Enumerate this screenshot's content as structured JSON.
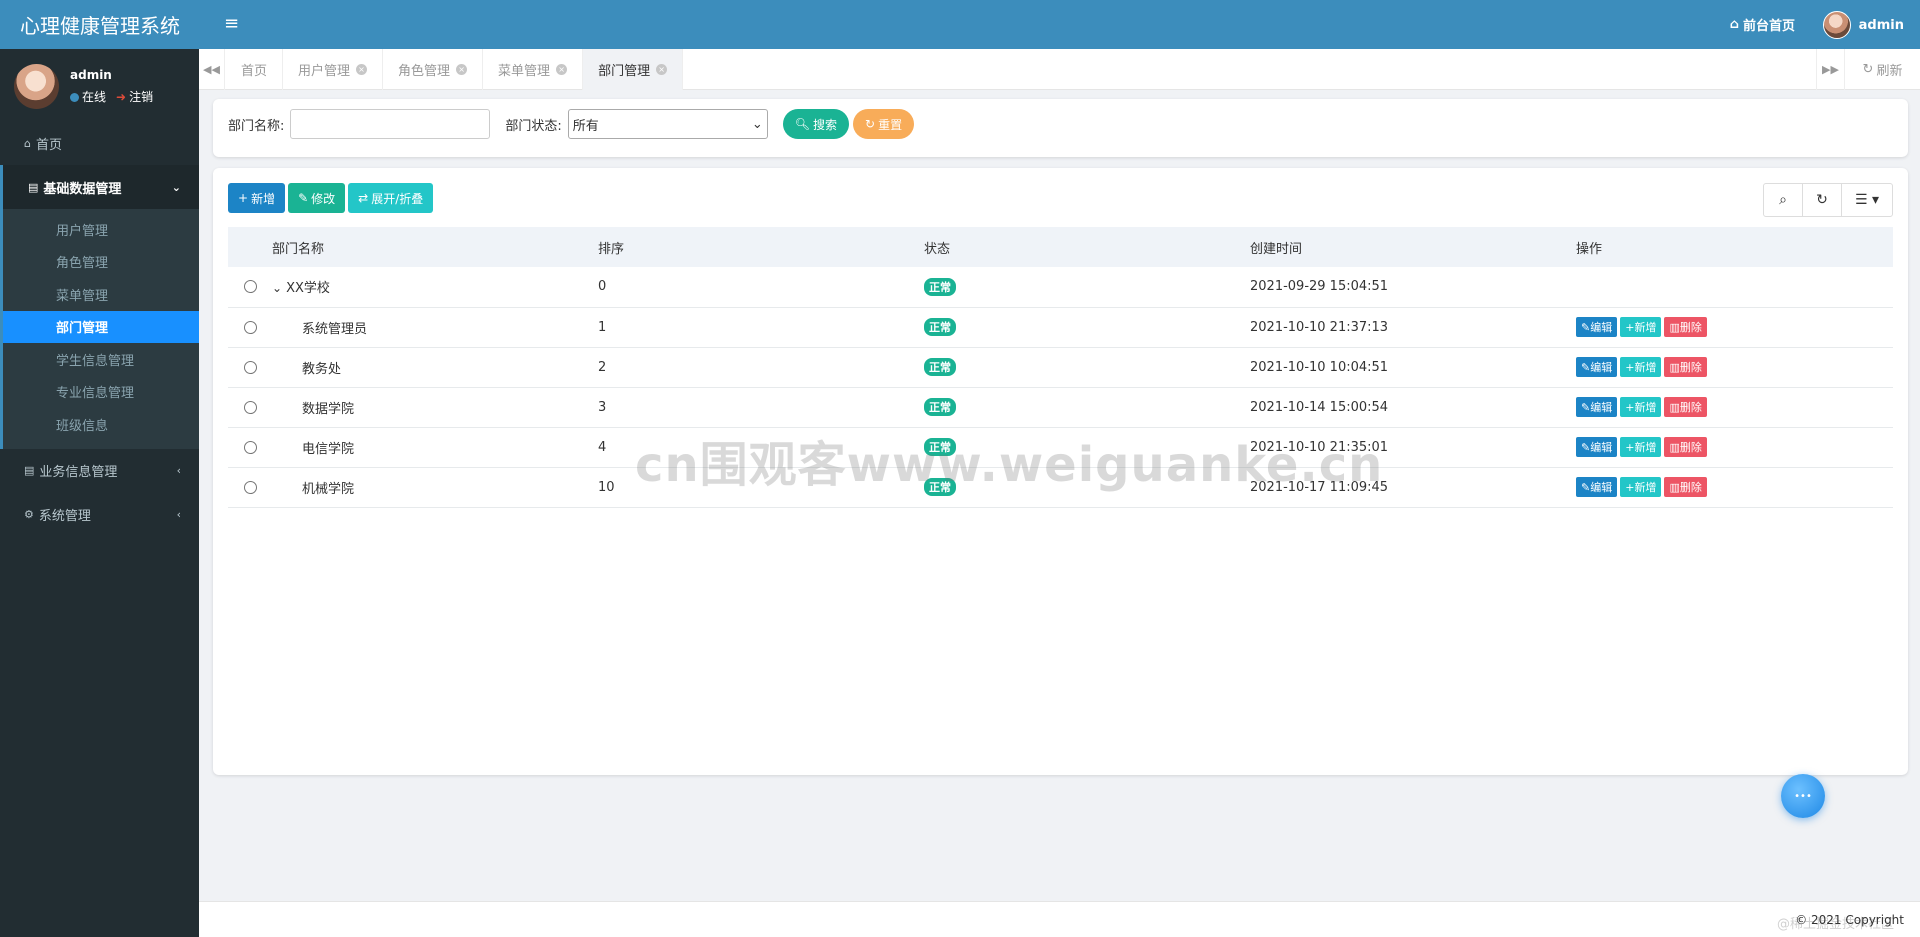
{
  "header": {
    "title": "心理健康管理系统",
    "menu_icon": "≡",
    "front_home": "前台首页",
    "user": "admin"
  },
  "sidebar": {
    "user_name": "admin",
    "online": "在线",
    "logout": "注销",
    "home": "首页",
    "groups": [
      {
        "label": "基础数据管理",
        "icon": "table-icon"
      },
      {
        "label": "业务信息管理",
        "icon": "table-icon"
      },
      {
        "label": "系统管理",
        "icon": "gear-icon"
      }
    ],
    "sub_items": [
      "用户管理",
      "角色管理",
      "菜单管理",
      "部门管理",
      "学生信息管理",
      "专业信息管理",
      "班级信息"
    ]
  },
  "tabs": {
    "items": [
      "首页",
      "用户管理",
      "角色管理",
      "菜单管理",
      "部门管理"
    ],
    "refresh": "刷新"
  },
  "search": {
    "dept_name_label": "部门名称:",
    "dept_status_label": "部门状态:",
    "status_selected": "所有",
    "search_btn": "搜索",
    "reset_btn": "重置"
  },
  "toolbar": {
    "add": "新增",
    "edit": "修改",
    "toggle": "展开/折叠"
  },
  "table": {
    "headers": [
      "部门名称",
      "排序",
      "状态",
      "创建时间",
      "操作"
    ],
    "rows": [
      {
        "name": "XX学校",
        "sort": "0",
        "status": "正常",
        "time": "2021-09-29 15:04:51"
      },
      {
        "name": "系统管理员",
        "sort": "1",
        "status": "正常",
        "time": "2021-10-10 21:37:13"
      },
      {
        "name": "教务处",
        "sort": "2",
        "status": "正常",
        "time": "2021-10-10 10:04:51"
      },
      {
        "name": "数据学院",
        "sort": "3",
        "status": "正常",
        "time": "2021-10-14 15:00:54"
      },
      {
        "name": "电信学院",
        "sort": "4",
        "status": "正常",
        "time": "2021-10-10 21:35:01"
      },
      {
        "name": "机械学院",
        "sort": "10",
        "status": "正常",
        "time": "2021-10-17 11:09:45"
      }
    ],
    "ops": {
      "edit": "编辑",
      "add": "新增",
      "delete": "删除"
    }
  },
  "watermark": "cn围观客www.weiguanke.cn",
  "footer": {
    "copyright": "© 2021 Copyright",
    "corner_mark": "@稀土掘金技术社区"
  }
}
